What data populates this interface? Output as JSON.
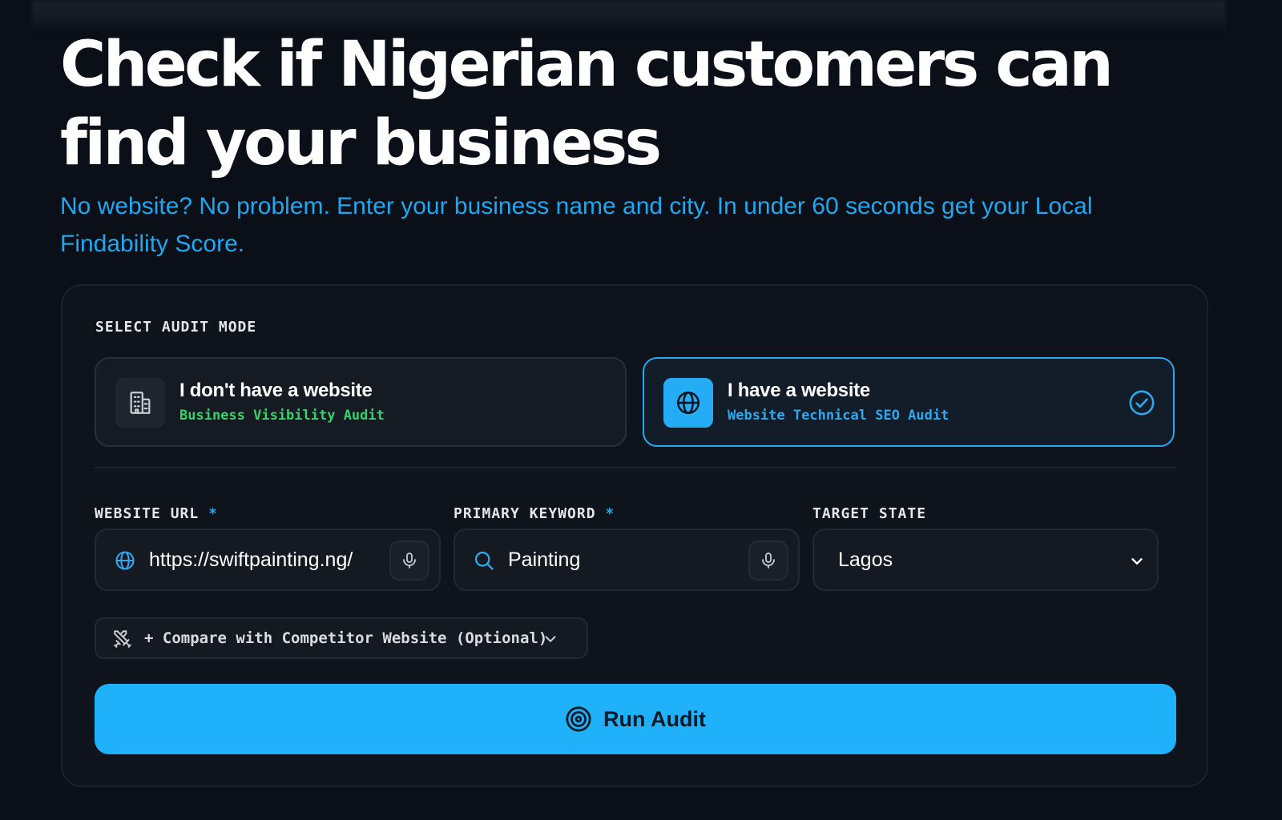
{
  "hero": {
    "title": "Check if Nigerian customers can find your business",
    "subtitle": "No website? No problem. Enter your business name and city. In under 60 seconds get your Local Findability Score."
  },
  "audit_form": {
    "mode_label": "SELECT AUDIT MODE",
    "modes": [
      {
        "title": "I don't have a website",
        "description": "Business Visibility Audit",
        "icon": "building-icon",
        "selected": false
      },
      {
        "title": "I have a website",
        "description": "Website Technical SEO Audit",
        "icon": "globe-icon",
        "selected": true
      }
    ],
    "fields": {
      "website_url": {
        "label": "WEBSITE URL",
        "required_mark": "*",
        "value": "https://swiftpainting.ng/"
      },
      "primary_keyword": {
        "label": "PRIMARY KEYWORD",
        "required_mark": "*",
        "value": "Painting"
      },
      "target_state": {
        "label": "TARGET STATE",
        "value": "Lagos"
      }
    },
    "compare_label": "+ Compare with Competitor Website (Optional)",
    "run_label": "Run Audit"
  },
  "colors": {
    "accent": "#1fb2fb",
    "link_blue": "#1fa8f0",
    "success_green": "#36d26a",
    "background": "#0b0f17"
  }
}
